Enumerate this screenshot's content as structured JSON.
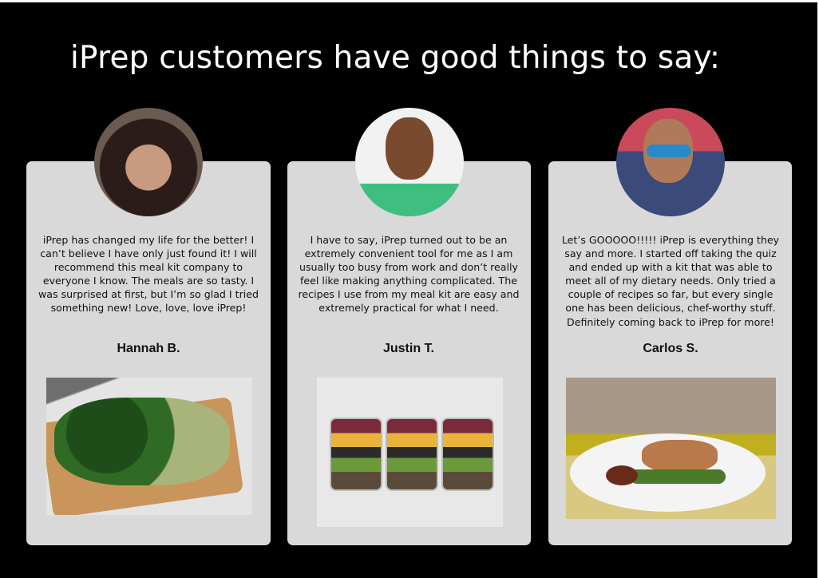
{
  "title": "iPrep customers have good things to say:",
  "testimonials": [
    {
      "quote": "iPrep has changed my life for the better! I can’t believe I have only just found it! I will recommend this meal kit company to everyone I know. The meals are so tasty. I was surprised at first, but I’m so glad I tried something new! Love, love, love iPrep!",
      "name": "Hannah B."
    },
    {
      "quote": "I have to say, iPrep turned out to be an extremely convenient tool for me as I am usually too busy from work and don’t really feel like making anything complicated. The recipes I use from my meal kit are easy and extremely practical for what I need.",
      "name": "Justin T."
    },
    {
      "quote": "Let’s GOOOOO!!!!! iPrep is everything they say and more. I started off taking the quiz and ended up with a kit that was able to meet all of my dietary needs. Only tried a couple of recipes so far, but every single one has been delicious, chef-worthy stuff. Definitely coming back to iPrep for more!",
      "name": "Carlos S."
    }
  ]
}
